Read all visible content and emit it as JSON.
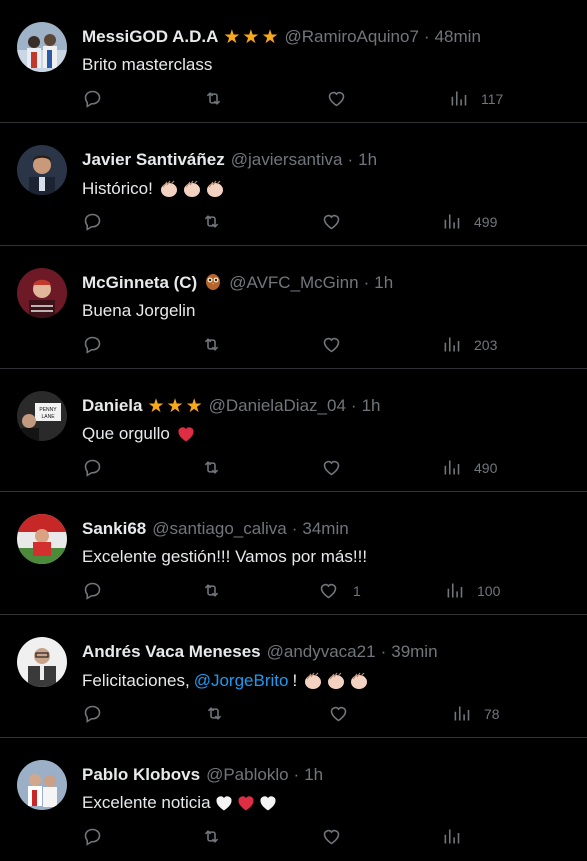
{
  "tweets": [
    {
      "name": "MessiGOD A.D.A",
      "badge": "stars",
      "handle": "@RamiroAquino7",
      "time": "48min",
      "text": "Brito masterclass",
      "likes": "",
      "views": "117",
      "avatar_color": "#6b7d95"
    },
    {
      "name": "Javier Santiváñez",
      "badge": "",
      "handle": "@javiersantiva",
      "time": "1h",
      "text": "Histórico!",
      "emoji": "claps",
      "likes": "",
      "views": "499",
      "avatar_color": "#4a3a2f"
    },
    {
      "name": "McGinneta (C)",
      "badge": "owl",
      "handle": "@AVFC_McGinn",
      "time": "1h",
      "text": "Buena Jorgelin",
      "likes": "",
      "views": "203",
      "avatar_color": "#7a1e2a"
    },
    {
      "name": "Daniela",
      "badge": "stars",
      "handle": "@DanielaDiaz_04",
      "time": "1h",
      "text": "Que orgullo",
      "emoji": "red-heart",
      "likes": "",
      "views": "490",
      "avatar_color": "#3b3b3b"
    },
    {
      "name": "Sanki68",
      "badge": "",
      "handle": "@santiago_caliva",
      "time": "34min",
      "text": "Excelente gestión!!! Vamos por más!!!",
      "likes": "1",
      "views": "100",
      "avatar_color": "#b72b2b"
    },
    {
      "name": "Andrés Vaca Meneses",
      "badge": "",
      "handle": "@andyvaca21",
      "time": "39min",
      "text": "Felicitaciones,",
      "mention": "@JorgeBrito",
      "after_mention": "!",
      "emoji": "claps",
      "likes": "",
      "views": "78",
      "avatar_color": "#d9d9d9"
    },
    {
      "name": "Pablo Klobovs",
      "badge": "",
      "handle": "@Pabloklo",
      "time": "1h",
      "text": "Excelente noticia",
      "emoji": "white-red-white-hearts",
      "likes": "",
      "views": "",
      "avatar_color": "#5c6f86"
    }
  ],
  "colors": {
    "background": "#000000",
    "text": "#e7e9ea",
    "muted": "#71767b",
    "link": "#1d9bf0",
    "star": "#f7a81b",
    "divider": "#2f3336"
  },
  "icons": [
    "reply-icon",
    "retweet-icon",
    "like-icon",
    "views-icon"
  ]
}
